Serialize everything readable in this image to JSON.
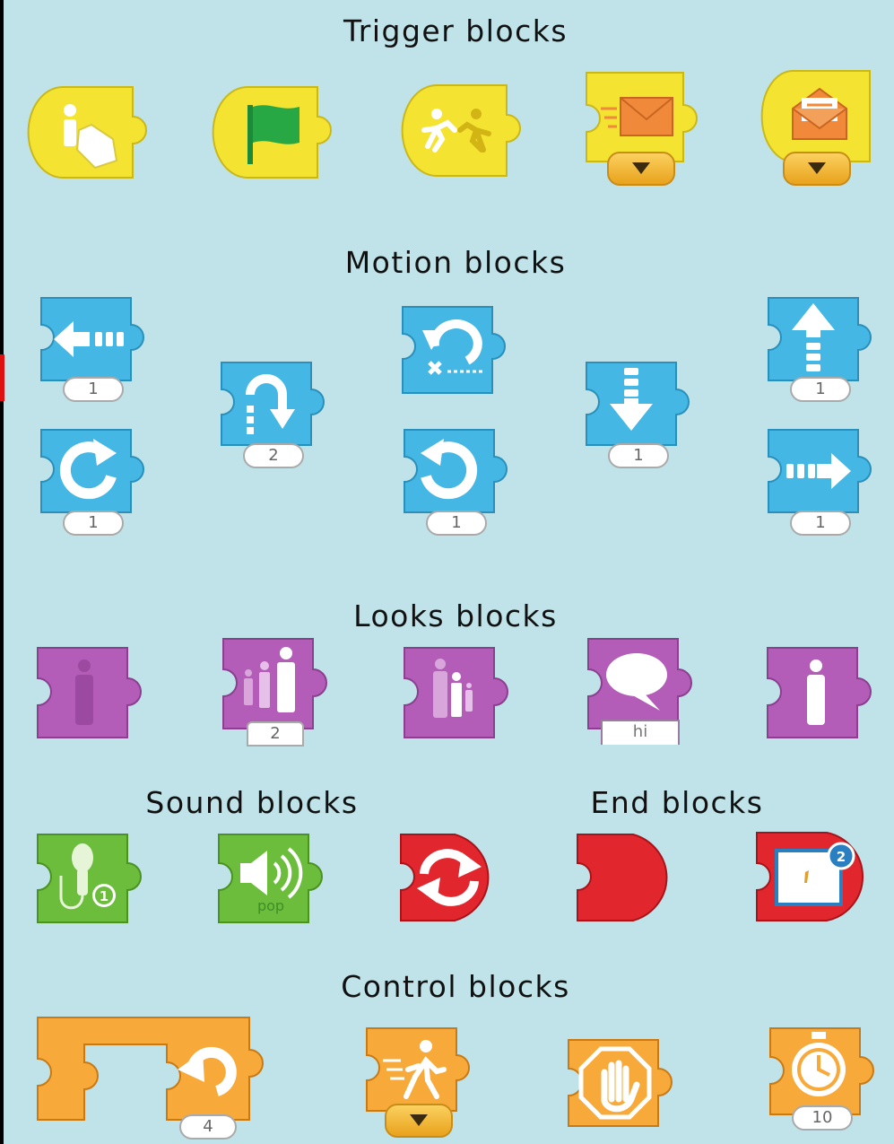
{
  "sections": {
    "trigger": "Trigger blocks",
    "motion": "Motion blocks",
    "looks": "Looks blocks",
    "sound": "Sound blocks",
    "end": "End blocks",
    "control": "Control blocks"
  },
  "motion_values": {
    "move_left": "1",
    "turn_right": "1",
    "hop": "2",
    "turn_left": "1",
    "move_down": "1",
    "move_up": "1",
    "move_right": "1"
  },
  "looks_values": {
    "grow": "2",
    "say": "hi"
  },
  "sound_values": {
    "record_badge": "1",
    "pop": "pop"
  },
  "end_values": {
    "go_to_page_badge": "2"
  },
  "control_values": {
    "repeat": "4",
    "wait": "10"
  },
  "colors": {
    "background": "#bfe3e8",
    "trigger": "#f5e331",
    "motion": "#45b7e4",
    "looks": "#b35db8",
    "sound": "#6cbd3c",
    "end": "#e2262d",
    "control": "#f7a93a"
  }
}
